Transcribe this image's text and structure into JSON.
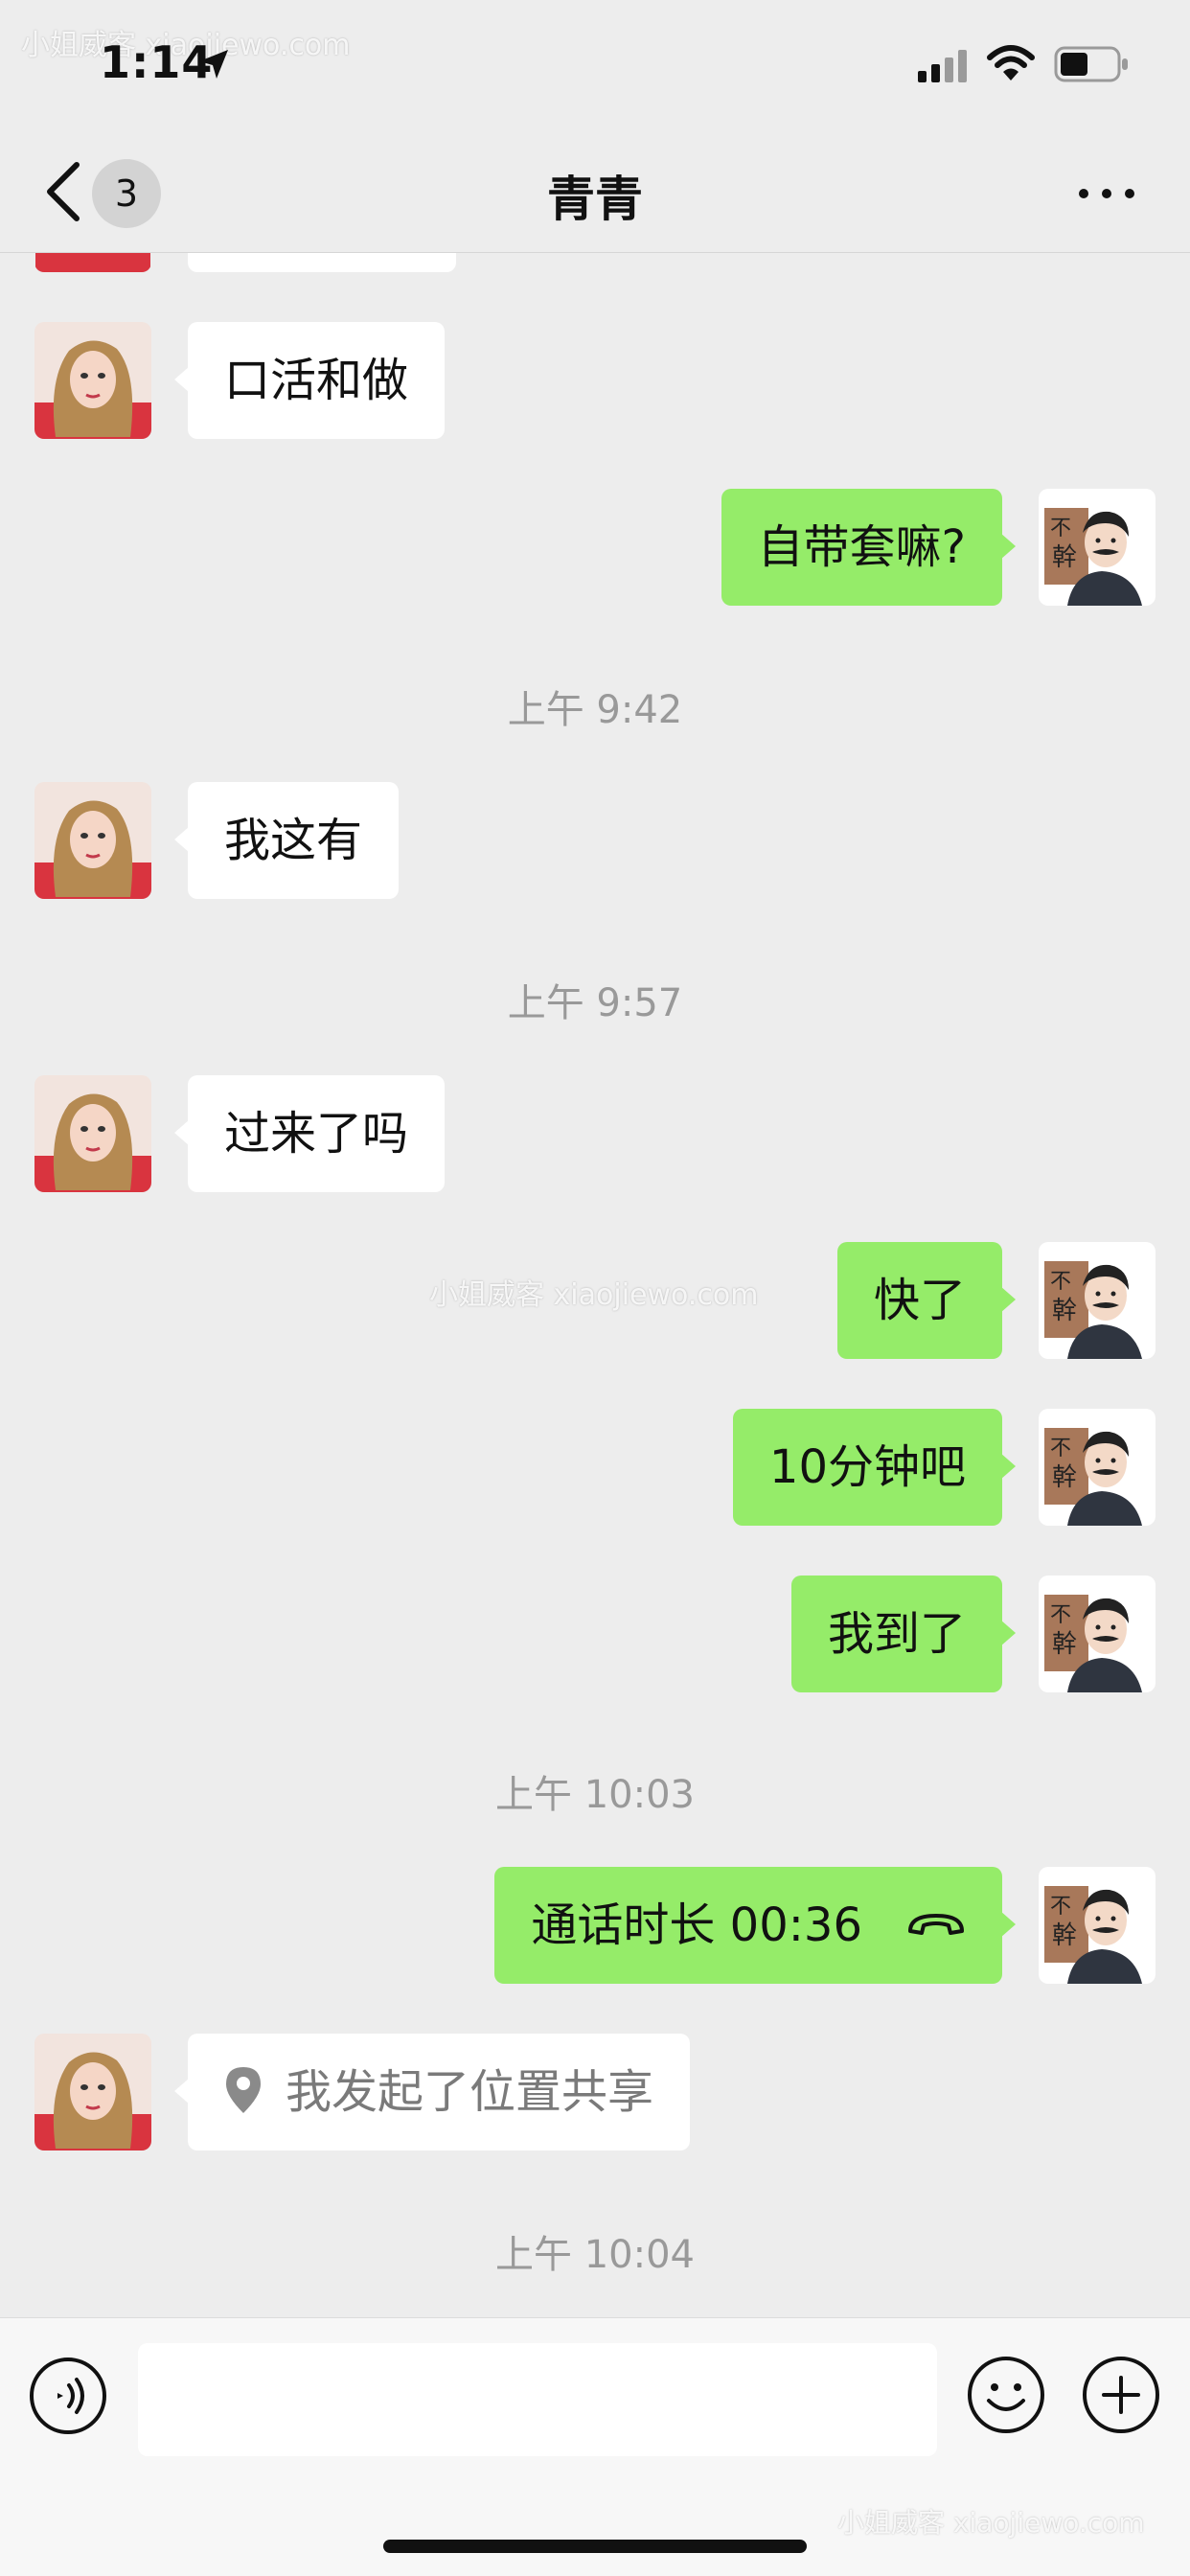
{
  "status_bar": {
    "time": "1:14",
    "watermark_top": "小姐威客 xiaojiewo.com"
  },
  "nav": {
    "title": "青青",
    "unread_count": "3"
  },
  "messages": [
    {
      "type": "text",
      "side": "left",
      "text": "口活和做"
    },
    {
      "type": "text",
      "side": "right",
      "text": "自带套嘛?"
    },
    {
      "type": "timestamp",
      "text": "上午 9:42"
    },
    {
      "type": "text",
      "side": "left",
      "text": "我这有"
    },
    {
      "type": "timestamp",
      "text": "上午 9:57"
    },
    {
      "type": "text",
      "side": "left",
      "text": "过来了吗"
    },
    {
      "type": "text",
      "side": "right",
      "text": "快了"
    },
    {
      "type": "text",
      "side": "right",
      "text": "10分钟吧"
    },
    {
      "type": "text",
      "side": "right",
      "text": "我到了"
    },
    {
      "type": "timestamp",
      "text": "上午 10:03"
    },
    {
      "type": "call",
      "side": "right",
      "text": "通话时长 00:36"
    },
    {
      "type": "location",
      "side": "left",
      "text": "我发起了位置共享"
    },
    {
      "type": "timestamp",
      "text": "上午 10:04"
    }
  ],
  "watermark_middle": "小姐威客 xiaojiewo.com",
  "watermark_bottom": "小姐威客 xiaojiewo.com",
  "input": {
    "placeholder": ""
  },
  "colors": {
    "background": "#ededed",
    "outgoing_bubble": "#95ec69",
    "incoming_bubble": "#ffffff",
    "timestamp": "#999999"
  }
}
